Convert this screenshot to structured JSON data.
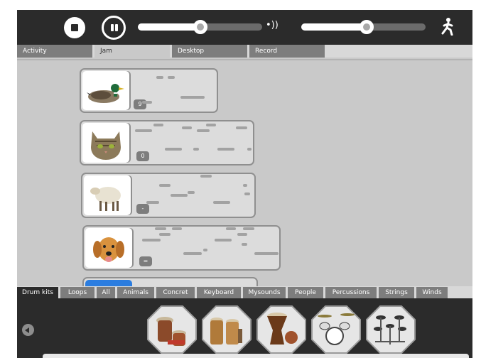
{
  "toolbar": {
    "stop_icon": "stop-icon",
    "pause_icon": "pause-icon",
    "volume_icon": "volume-icon",
    "tempo_icon": "running-figure-icon",
    "volume_level": 0.52,
    "tempo_level": 0.52
  },
  "tabs": [
    "Activity",
    "Jam",
    "Desktop",
    "Record"
  ],
  "active_tab": "Jam",
  "tracks": [
    {
      "name": "duck",
      "icon": "duck-icon",
      "badge": "9"
    },
    {
      "name": "cat",
      "icon": "cat-icon",
      "badge": "0"
    },
    {
      "name": "sheep",
      "icon": "sheep-icon",
      "badge": "-"
    },
    {
      "name": "dog",
      "icon": "dog-icon",
      "badge": "="
    }
  ],
  "categories": [
    "Drum kits",
    "Loops",
    "All",
    "Animals",
    "Concret",
    "Keyboard",
    "Mysounds",
    "People",
    "Percussions",
    "Strings",
    "Winds"
  ],
  "active_category": "Drum kits",
  "instruments": [
    {
      "name": "african-drums",
      "icon": "african-drums-icon"
    },
    {
      "name": "bongos",
      "icon": "bongos-icon"
    },
    {
      "name": "djembe",
      "icon": "djembe-icon"
    },
    {
      "name": "drum-kit",
      "icon": "drum-kit-icon"
    },
    {
      "name": "electronic-drum-kit",
      "icon": "electronic-drum-kit-icon"
    }
  ],
  "colors": {
    "toolbar": "#2b2b2b",
    "canvas": "#c9c9c9",
    "tab": "#7d7d7d",
    "selected_track": "#2b7de0"
  }
}
